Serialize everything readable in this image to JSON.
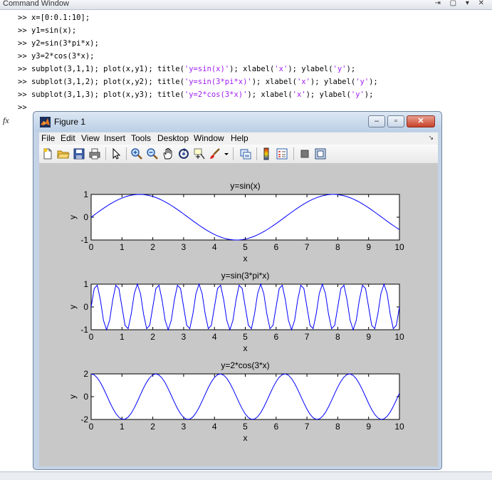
{
  "command_window": {
    "title": "Command Window",
    "controls": "⇥ ▢ ▾ ✕",
    "prompt_fx": "fx",
    "lines": [
      {
        "prompt": ">> ",
        "code": "x=[0:0.1:10];"
      },
      {
        "prompt": ">> ",
        "code": "y1=sin(x);"
      },
      {
        "prompt": ">> ",
        "code": "y2=sin(3*pi*x);"
      },
      {
        "prompt": ">> ",
        "code": "y3=2*cos(3*x);"
      },
      {
        "prompt": ">> ",
        "pre": "subplot(3,1,1); plot(x,y1); title(",
        "s1": "'y=sin(x)'",
        "mid": "); xlabel(",
        "s2": "'x'",
        "mid2": "); ylabel(",
        "s3": "'y'",
        "post": ");"
      },
      {
        "prompt": ">> ",
        "pre": "subplot(3,1,2); plot(x,y2); title(",
        "s1": "'y=sin(3*pi*x)'",
        "mid": "); xlabel(",
        "s2": "'x'",
        "mid2": "); ylabel(",
        "s3": "'y'",
        "post": ");"
      },
      {
        "prompt": ">> ",
        "pre": "subplot(3,1,3); plot(x,y3); title(",
        "s1": "'y=2*cos(3*x)'",
        "mid": "); xlabel(",
        "s2": "'x'",
        "mid2": "); ylabel(",
        "s3": "'y'",
        "post": ");"
      },
      {
        "prompt": ">> ",
        "code": ""
      }
    ]
  },
  "figure": {
    "title": "Figure 1",
    "window_buttons": {
      "minimize": "–",
      "maximize": "▫",
      "close": "✕"
    },
    "menu": [
      "File",
      "Edit",
      "View",
      "Insert",
      "Tools",
      "Desktop",
      "Window",
      "Help"
    ],
    "menu_arrow": "↘",
    "toolbar_icons": [
      "new-figure-icon",
      "open-file-icon",
      "save-icon",
      "print-icon",
      "pointer-icon",
      "zoom-in-icon",
      "zoom-out-icon",
      "pan-icon",
      "rotate-icon",
      "data-cursor-icon",
      "brush-icon",
      "link-icon",
      "colorbar-icon",
      "legend-icon",
      "hide-plot-tools-icon",
      "show-plot-tools-icon"
    ],
    "line_color": "#0000ff"
  },
  "chart_data": [
    {
      "type": "line",
      "title": "y=sin(x)",
      "xlabel": "x",
      "ylabel": "y",
      "xlim": [
        0,
        10
      ],
      "ylim": [
        -1,
        1
      ],
      "xticks": [
        0,
        1,
        2,
        3,
        4,
        5,
        6,
        7,
        8,
        9,
        10
      ],
      "yticks": [
        -1,
        0,
        1
      ],
      "series": [
        {
          "function": "sin(x)",
          "x": {
            "start": 0,
            "step": 0.1,
            "end": 10
          }
        }
      ]
    },
    {
      "type": "line",
      "title": "y=sin(3*pi*x)",
      "xlabel": "x",
      "ylabel": "y",
      "xlim": [
        0,
        10
      ],
      "ylim": [
        -1,
        1
      ],
      "xticks": [
        0,
        1,
        2,
        3,
        4,
        5,
        6,
        7,
        8,
        9,
        10
      ],
      "yticks": [
        -1,
        0,
        1
      ],
      "series": [
        {
          "function": "sin(3*pi*x)",
          "x": {
            "start": 0,
            "step": 0.1,
            "end": 10
          }
        }
      ]
    },
    {
      "type": "line",
      "title": "y=2*cos(3*x)",
      "xlabel": "x",
      "ylabel": "y",
      "xlim": [
        0,
        10
      ],
      "ylim": [
        -2,
        2
      ],
      "xticks": [
        0,
        1,
        2,
        3,
        4,
        5,
        6,
        7,
        8,
        9,
        10
      ],
      "yticks": [
        -2,
        0,
        2
      ],
      "series": [
        {
          "function": "2*cos(3*x)",
          "x": {
            "start": 0,
            "step": 0.1,
            "end": 10
          }
        }
      ]
    }
  ]
}
